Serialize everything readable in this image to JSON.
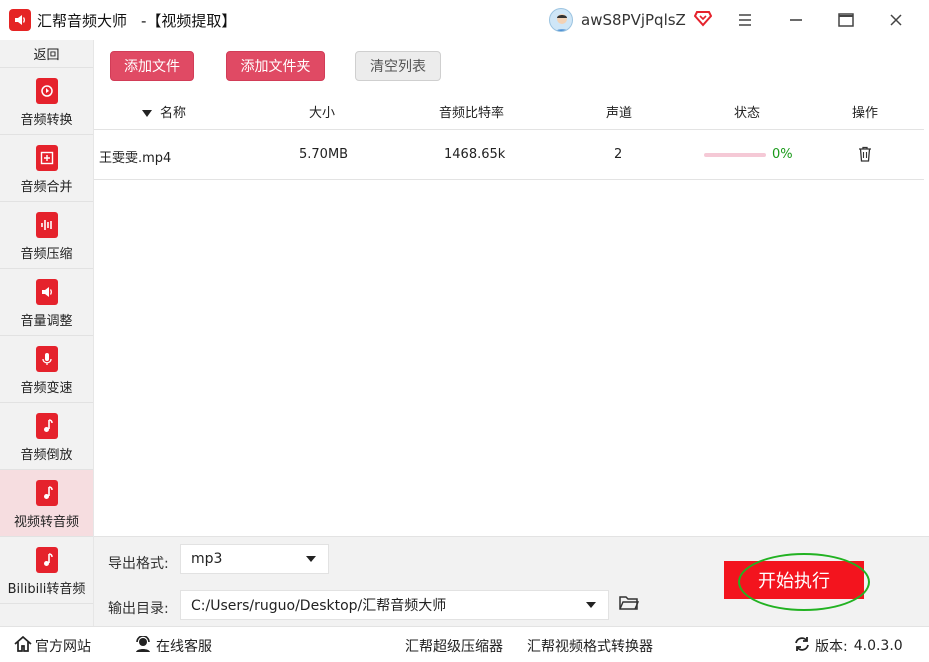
{
  "window": {
    "app_title": "汇帮音频大师",
    "mode_title": "-【视频提取】",
    "username": "awS8PVjPqlsZ",
    "icons": {
      "logo": "speaker-logo-icon",
      "vip": "vip-diamond-icon",
      "menu": "menu-icon",
      "minimize": "minimize-icon",
      "maximize": "maximize-icon",
      "close": "close-icon"
    }
  },
  "sidebar": {
    "back_label": "返回",
    "items": [
      {
        "label": "音频转换",
        "icon": "audio-convert-icon"
      },
      {
        "label": "音频合并",
        "icon": "audio-merge-icon"
      },
      {
        "label": "音频压缩",
        "icon": "audio-compress-icon"
      },
      {
        "label": "音量调整",
        "icon": "volume-adjust-icon"
      },
      {
        "label": "音频变速",
        "icon": "audio-speed-icon"
      },
      {
        "label": "音频倒放",
        "icon": "audio-reverse-icon"
      },
      {
        "label": "视频转音频",
        "icon": "video-to-audio-icon",
        "active": true
      },
      {
        "label": "Bilibili转音频",
        "icon": "bilibili-to-audio-icon"
      }
    ]
  },
  "toolbar": {
    "add_file": "添加文件",
    "add_folder": "添加文件夹",
    "clear_list": "清空列表"
  },
  "table": {
    "headers": [
      "名称",
      "大小",
      "音频比特率",
      "声道",
      "状态",
      "操作"
    ],
    "rows": [
      {
        "name": "王雯雯.mp4",
        "size": "5.70MB",
        "bitrate": "1468.65k",
        "channels": "2",
        "progress": 0,
        "progress_text": "0%"
      }
    ]
  },
  "settings": {
    "format_label": "导出格式:",
    "format_value": "mp3",
    "dir_label": "输出目录:",
    "dir_value": "C:/Users/ruguo/Desktop/汇帮音频大师"
  },
  "start_button": "开始执行",
  "footer": {
    "website": "官方网站",
    "support": "在线客服",
    "compressor": "汇帮超级压缩器",
    "video_converter": "汇帮视频格式转换器",
    "version_label": "版本:",
    "version_value": "4.0.3.0"
  },
  "colors": {
    "accent_red": "#e5222c",
    "button_pink": "#e04a64",
    "start_red": "#f3141e",
    "progress_green": "#1a9a1a",
    "highlight_green": "#22b222"
  }
}
